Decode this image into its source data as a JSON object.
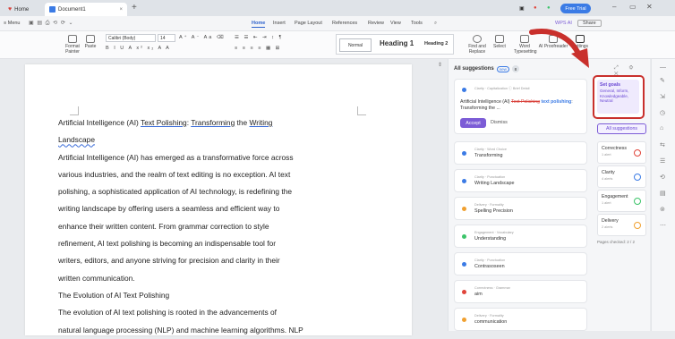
{
  "titlebar": {
    "home_tab": "Home",
    "doc_tab": "Document1",
    "free_trial": "Free Trial",
    "close_glyph": "×",
    "plus_glyph": "+"
  },
  "menubar": {
    "menu_label": "≡ Menu",
    "items": [
      "Home",
      "Insert",
      "Page Layout",
      "References",
      "Review",
      "View",
      "Tools"
    ],
    "wps_ai": "WPS AI",
    "share": "Share"
  },
  "ribbon": {
    "format_painter": "Format Painter",
    "paste": "Paste",
    "font_name": "Calibri (Body)",
    "font_size": "14",
    "style_normal": "Normal",
    "style_h1": "Heading 1",
    "style_h2": "Heading 2",
    "find_replace": "Find and Replace",
    "select": "Select",
    "word_typesetting": "Word Typesetting",
    "ai_proofreader": "AI Proofreader",
    "settings": "Settings"
  },
  "document": {
    "title_prefix": "Artificial Intelligence (AI) ",
    "title_u1": "Text Polishing",
    "title_colon": ": ",
    "title_u2": "Transforming",
    "title_mid": " the ",
    "title_u3": "Writing",
    "title_u4": "Landscape",
    "lines": [
      "Artificial Intelligence (AI) has emerged as a transformative force across",
      "various industries, and the realm of text editing is no exception. AI text",
      "polishing, a sophisticated application of AI technology, is redefining the",
      "writing landscape by offering users a seamless and efficient way to",
      "enhance their written content. From grammar correction to style",
      "refinement, AI text polishing is becoming an indispensable tool for",
      "writers, editors, and anyone striving for precision and clarity in their",
      "written communication.",
      "The Evolution of AI Text Polishing",
      "The evolution of AI text polishing is rooted in the advancements of",
      "natural language processing (NLP) and machine learning algorithms. NLP"
    ]
  },
  "panel": {
    "title": "All suggestions",
    "new_chip": "new",
    "count": "8",
    "main_card": {
      "category": "Clarity · Capitalization",
      "category_extra": "Brief Detail",
      "text_before": "Artificial Intelligence (AI) ",
      "struck": "Text Polishing",
      "inserted": "text polishing",
      "text_after": ": Transforming the ...",
      "accept": "Accept",
      "dismiss": "Dismiss"
    },
    "cards": [
      {
        "category": "Clarity · Word Choice",
        "word": "Transforming",
        "color": "#3b7be5"
      },
      {
        "category": "Clarity · Punctuation",
        "word": "Writing Landscape",
        "color": "#3b7be5"
      },
      {
        "category": "Delivery · Formality",
        "word": "Spelling Precision",
        "color": "#f0a030"
      },
      {
        "category": "Engagement · Vocabulary",
        "word": "Understanding",
        "color": "#3cc46a"
      },
      {
        "category": "Clarity · Punctuation",
        "word": "Contrasoseen",
        "color": "#3b7be5"
      },
      {
        "category": "Correctness · Grammar",
        "word": "aim",
        "color": "#e0443a"
      },
      {
        "category": "Delivery · Formality",
        "word": "communication",
        "color": "#f0a030"
      }
    ],
    "goals": {
      "title": "Set goals",
      "subtitle": "General, Inform, Knowledgeable, Neutral"
    },
    "all_suggestions_btn": "All suggestions",
    "goal_cards": [
      {
        "name": "Correctness",
        "count": "1 alert",
        "color": "#e0443a"
      },
      {
        "name": "Clarity",
        "count": "4 alerts",
        "color": "#3b7be5"
      },
      {
        "name": "Engagement",
        "count": "1 alert",
        "color": "#3cc46a"
      },
      {
        "name": "Delivery",
        "count": "2 alerts",
        "color": "#f0a030"
      }
    ],
    "pages_checked": "Pages checked: 2 / 2"
  },
  "colors": {
    "accent_blue": "#3b7be5",
    "accept_purple": "#7c5cd6",
    "highlight_red": "#c9302c"
  }
}
